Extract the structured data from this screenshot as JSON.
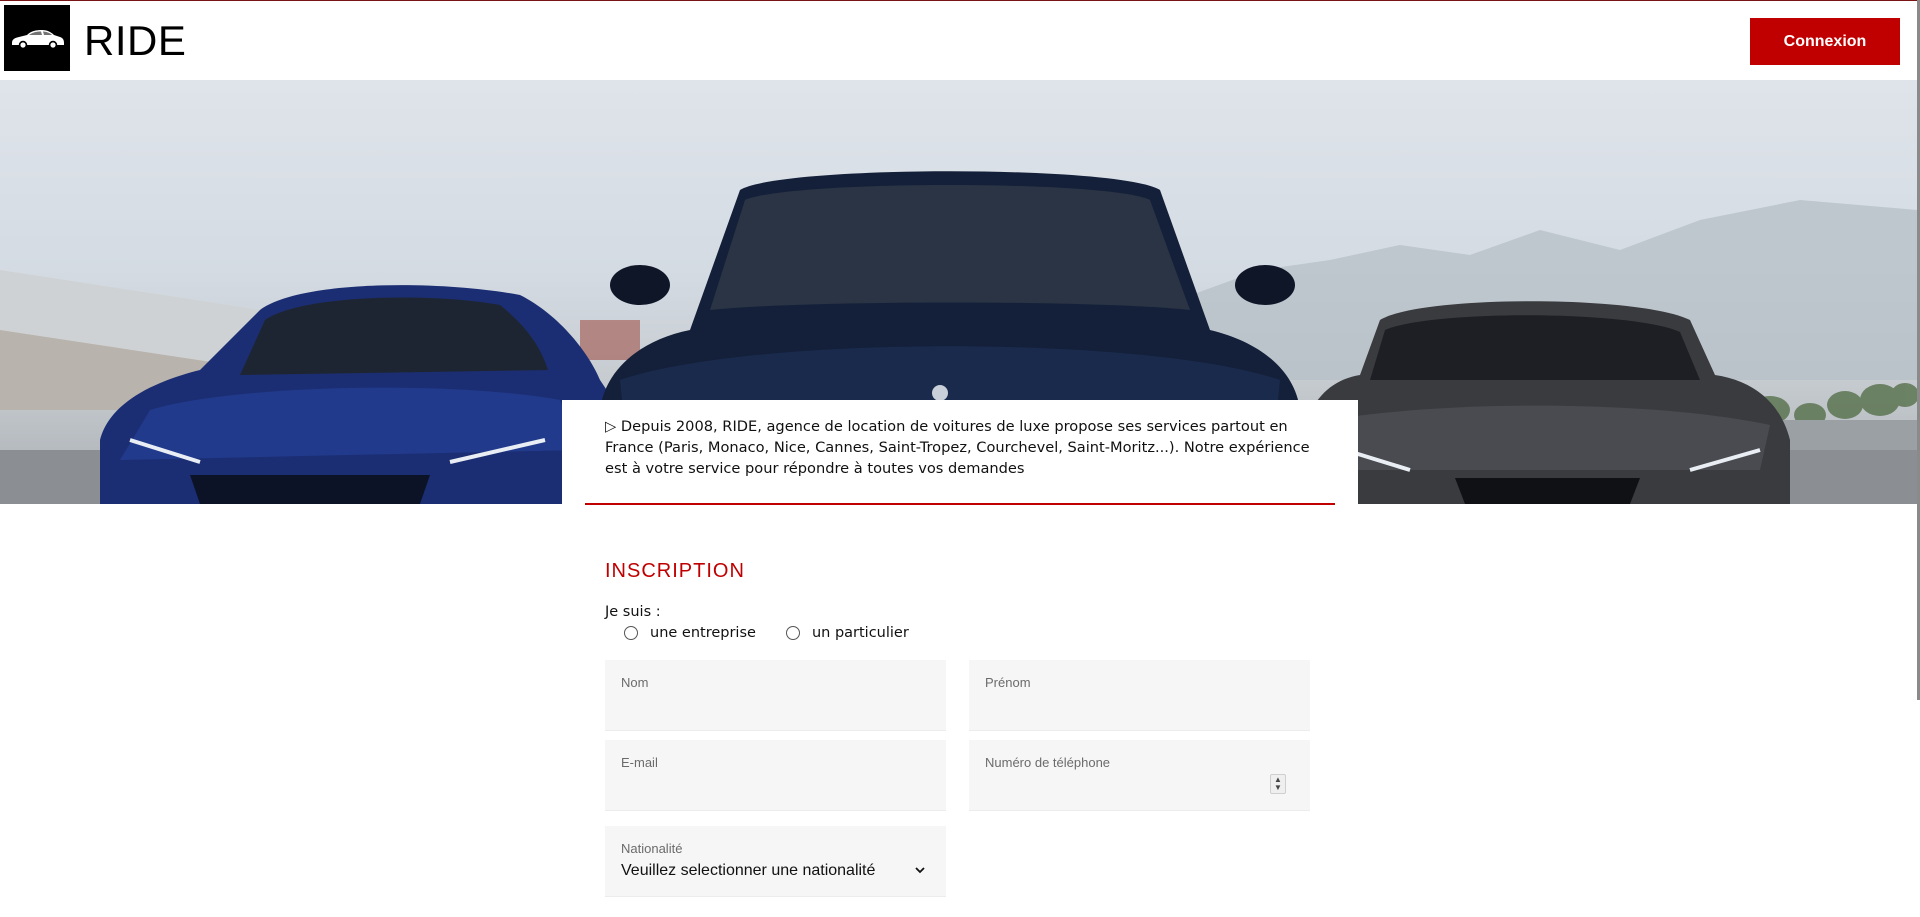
{
  "brand": {
    "name": "RIDE",
    "logo_icon": "car-icon"
  },
  "header": {
    "login_label": "Connexion",
    "accent_color": "#c00000"
  },
  "hero": {
    "image": "hero-cars"
  },
  "intro": {
    "text": "▷ Depuis 2008, RIDE, agence de location de voitures de luxe propose ses services partout en France (Paris, Monaco, Nice, Cannes, Saint-Tropez, Courchevel, Saint-Moritz...). Notre expérience est à votre service pour répondre à toutes vos demandes"
  },
  "form": {
    "title": "INSCRIPTION",
    "i_am_label": "Je suis :",
    "options": [
      {
        "label": "une entreprise",
        "checked": false
      },
      {
        "label": "un particulier",
        "checked": false
      }
    ],
    "fields": {
      "nom": {
        "label": "Nom",
        "value": ""
      },
      "prenom": {
        "label": "Prénom",
        "value": ""
      },
      "email": {
        "label": "E-mail",
        "value": ""
      },
      "telephone": {
        "label": "Numéro de téléphone",
        "value": ""
      },
      "nationalite": {
        "label": "Nationalité",
        "value": "Veuillez selectionner une nationalité"
      }
    }
  }
}
